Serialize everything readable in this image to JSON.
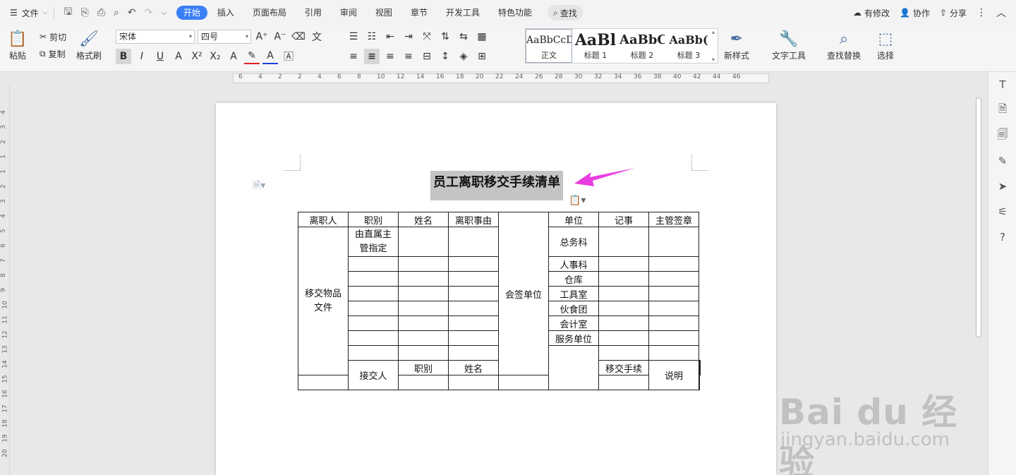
{
  "menubar": {
    "file_label": "文件",
    "tabs": [
      "开始",
      "插入",
      "页面布局",
      "引用",
      "审阅",
      "视图",
      "章节",
      "开发工具",
      "特色功能"
    ],
    "search_label": "查找",
    "modified_label": "有修改",
    "collab_label": "协作",
    "share_label": "分享"
  },
  "ribbon": {
    "paste": "粘贴",
    "cut": "剪切",
    "copy": "复制",
    "format_painter": "格式刷",
    "font_name": "宋体",
    "font_size": "四号",
    "styles": [
      {
        "preview": "AaBbCcDd",
        "name": "正文"
      },
      {
        "preview": "AaBl",
        "name": "标题 1"
      },
      {
        "preview": "AaBbC",
        "name": "标题 2"
      },
      {
        "preview": "AaBb(",
        "name": "标题 3"
      }
    ],
    "new_style": "新样式",
    "text_tools": "文字工具",
    "find_replace": "查找替换",
    "select": "选择"
  },
  "ruler": {
    "h_ticks": [
      "6",
      "4",
      "2",
      "2",
      "4",
      "6",
      "8",
      "10",
      "12",
      "14",
      "16",
      "18",
      "20",
      "22",
      "24",
      "26",
      "28",
      "30",
      "32",
      "34",
      "36",
      "38",
      "40",
      "42",
      "44",
      "46"
    ],
    "v_ticks": [
      "4",
      "3",
      "2",
      "1",
      "1",
      "2",
      "3",
      "4",
      "5",
      "6",
      "7",
      "8",
      "9",
      "10",
      "11",
      "12",
      "13",
      "14",
      "15",
      "16",
      "17",
      "18",
      "19",
      "20"
    ]
  },
  "document": {
    "title": "员工离职移交手续清单",
    "table": {
      "row0": [
        "离职人",
        "职别",
        "姓名",
        "离职事由",
        "单位",
        "记事",
        "主管签章"
      ],
      "handover_items": "移交物品文件",
      "assigned_by": "由直属主管指定",
      "countersign": "会签单位",
      "units": [
        "总务科",
        "人事科",
        "仓库",
        "工具室",
        "伙食团",
        "会计室",
        "服务单位"
      ],
      "receiver": "接交人",
      "receiver_cols": [
        "职别",
        "姓名",
        "移交手续"
      ],
      "remarks": "说明"
    }
  },
  "watermark": {
    "line1": "Bai du 经验",
    "line2": "jingyan.baidu.com"
  }
}
